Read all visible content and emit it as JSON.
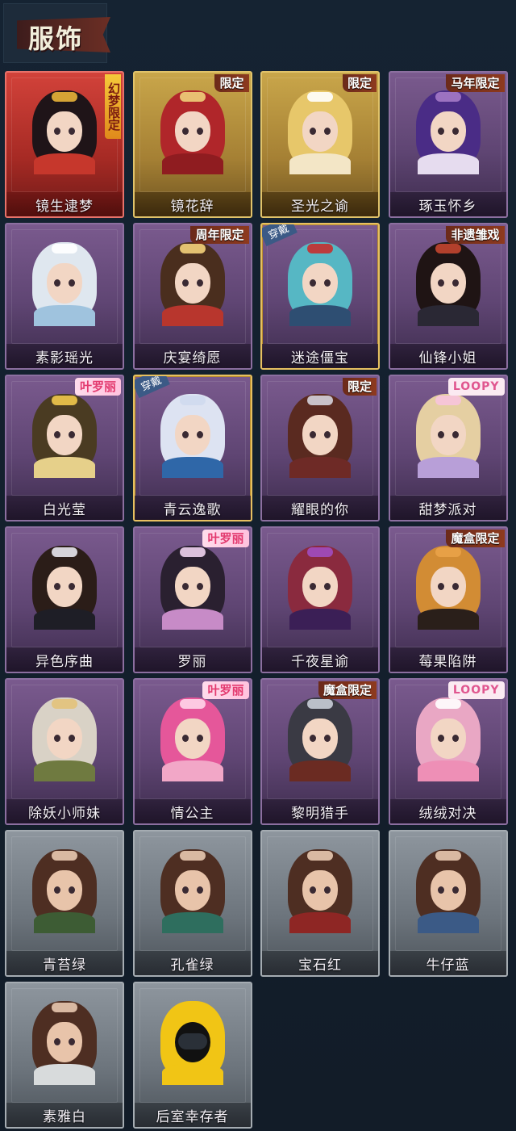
{
  "header": {
    "title": "服饰"
  },
  "costumes": [
    {
      "name": "镜生逮梦",
      "badge": "幻梦限定",
      "badge_style": "vert",
      "frame": "red",
      "hair": "#1f1418",
      "outfit": "#c6372c",
      "accent": "#e9b339",
      "worn": false
    },
    {
      "name": "镜花辞",
      "badge": "限定",
      "badge_style": "plain",
      "frame": "gold",
      "hair": "#b0262a",
      "outfit": "#8f1c20",
      "accent": "#f0d07a",
      "worn": false
    },
    {
      "name": "圣光之谕",
      "badge": "限定",
      "badge_style": "plain",
      "frame": "gold",
      "hair": "#e7c76a",
      "outfit": "#f3e6c6",
      "accent": "#ffffff",
      "worn": false
    },
    {
      "name": "琢玉怀乡",
      "badge": "马年限定",
      "badge_style": "plain",
      "frame": "purple",
      "hair": "#4a2c86",
      "outfit": "#e6dcef",
      "accent": "#a57ac8",
      "worn": false
    },
    {
      "name": "素影瑶光",
      "badge": "",
      "badge_style": "",
      "frame": "purple",
      "hair": "#dfe7ef",
      "outfit": "#9fc3de",
      "accent": "#ffffff",
      "worn": false
    },
    {
      "name": "庆宴绮愿",
      "badge": "周年限定",
      "badge_style": "plain",
      "frame": "purple",
      "hair": "#4a2e1e",
      "outfit": "#b8362d",
      "accent": "#f4d27a",
      "worn": false
    },
    {
      "name": "迷途僵宝",
      "badge": "",
      "badge_style": "",
      "frame": "purple",
      "hair": "#56b7c4",
      "outfit": "#2e4e72",
      "accent": "#c62f2f",
      "worn": true,
      "wear_label": "穿戴"
    },
    {
      "name": "仙锋小姐",
      "badge": "非遗雏戏",
      "badge_style": "plain",
      "frame": "purple",
      "hair": "#1f1414",
      "outfit": "#2a2834",
      "accent": "#c3452f",
      "worn": false
    },
    {
      "name": "白光莹",
      "badge": "叶罗丽",
      "badge_style": "pink",
      "frame": "purple",
      "hair": "#4a3b22",
      "outfit": "#e6d08a",
      "accent": "#f2c94c",
      "worn": false
    },
    {
      "name": "青云逸歌",
      "badge": "",
      "badge_style": "",
      "frame": "purple",
      "hair": "#dde3f2",
      "outfit": "#2f67a8",
      "accent": "#cfd9ee",
      "worn": true,
      "wear_label": "穿戴"
    },
    {
      "name": "耀眼的你",
      "badge": "限定",
      "badge_style": "plain",
      "frame": "purple",
      "hair": "#5a2a20",
      "outfit": "#6e2a26",
      "accent": "#d5d3dc",
      "worn": false
    },
    {
      "name": "甜梦派对",
      "badge": "LOOPY",
      "badge_style": "loopy",
      "frame": "purple",
      "hair": "#e5cfa2",
      "outfit": "#b89fd8",
      "accent": "#f7c3dd",
      "worn": false
    },
    {
      "name": "异色序曲",
      "badge": "",
      "badge_style": "",
      "frame": "purple",
      "hair": "#2b1d18",
      "outfit": "#1e1e26",
      "accent": "#e8e8ee",
      "worn": false
    },
    {
      "name": "罗丽",
      "badge": "叶罗丽",
      "badge_style": "pink",
      "frame": "purple",
      "hair": "#2a2030",
      "outfit": "#c78bc7",
      "accent": "#f0d3f0",
      "worn": false
    },
    {
      "name": "千夜星谕",
      "badge": "",
      "badge_style": "",
      "frame": "purple",
      "hair": "#8a2a3e",
      "outfit": "#3b1f56",
      "accent": "#a04cc0",
      "worn": false
    },
    {
      "name": "莓果陷阱",
      "badge": "魔盒限定",
      "badge_style": "plain",
      "frame": "purple",
      "hair": "#d28c34",
      "outfit": "#2a1f1a",
      "accent": "#e9a248",
      "worn": false
    },
    {
      "name": "除妖小师妹",
      "badge": "",
      "badge_style": "",
      "frame": "purple",
      "hair": "#d9d2c6",
      "outfit": "#6f7a40",
      "accent": "#e2c27a",
      "worn": false
    },
    {
      "name": "情公主",
      "badge": "叶罗丽",
      "badge_style": "pink",
      "frame": "purple",
      "hair": "#e5579a",
      "outfit": "#f2a7c7",
      "accent": "#ffd6ea",
      "worn": false
    },
    {
      "name": "黎明猎手",
      "badge": "魔盒限定",
      "badge_style": "plain",
      "frame": "purple",
      "hair": "#3a3a44",
      "outfit": "#6b2b22",
      "accent": "#c9ced8",
      "worn": false
    },
    {
      "name": "绒绒对决",
      "badge": "LOOPY",
      "badge_style": "loopy",
      "frame": "purple",
      "hair": "#e9a7c4",
      "outfit": "#ee8fb6",
      "accent": "#ffffff",
      "worn": false
    },
    {
      "name": "青苔绿",
      "badge": "",
      "badge_style": "",
      "frame": "gray",
      "hair": "#4e2e22",
      "outfit": "#3d5c34",
      "accent": "#e9c9b0",
      "worn": false
    },
    {
      "name": "孔雀绿",
      "badge": "",
      "badge_style": "",
      "frame": "gray",
      "hair": "#4e2e22",
      "outfit": "#2e6e5e",
      "accent": "#e9c9b0",
      "worn": false
    },
    {
      "name": "宝石红",
      "badge": "",
      "badge_style": "",
      "frame": "gray",
      "hair": "#4e2e22",
      "outfit": "#8e2624",
      "accent": "#e9c9b0",
      "worn": false
    },
    {
      "name": "牛仔蓝",
      "badge": "",
      "badge_style": "",
      "frame": "gray",
      "hair": "#4e2e22",
      "outfit": "#3b5a86",
      "accent": "#e9c9b0",
      "worn": false
    },
    {
      "name": "素雅白",
      "badge": "",
      "badge_style": "",
      "frame": "gray",
      "hair": "#4e2e22",
      "outfit": "#d8dbdc",
      "accent": "#e9c9b0",
      "worn": false
    },
    {
      "name": "后室幸存者",
      "badge": "",
      "badge_style": "",
      "frame": "gray",
      "hair": "#f1c515",
      "outfit": "#f1c515",
      "accent": "#111111",
      "worn": false,
      "masked": true
    }
  ]
}
